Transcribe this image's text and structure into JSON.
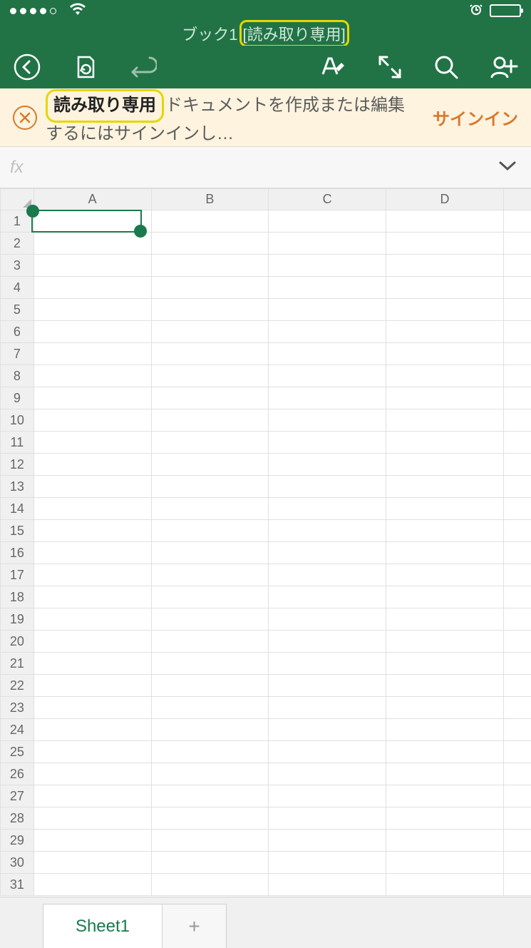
{
  "title": {
    "name": "ブック1",
    "suffix": "[読み取り専用]"
  },
  "banner": {
    "strong": "読み取り専用",
    "text_rest": "ドキュメントを作成または編集するにはサインインし…",
    "cta": "サインイン"
  },
  "formula_bar": {
    "fx": "fx",
    "value": ""
  },
  "columns": [
    "A",
    "B",
    "C",
    "D",
    ""
  ],
  "rows": [
    "1",
    "2",
    "3",
    "4",
    "5",
    "6",
    "7",
    "8",
    "9",
    "10",
    "11",
    "12",
    "13",
    "14",
    "15",
    "16",
    "17",
    "18",
    "19",
    "20",
    "21",
    "22",
    "23",
    "24",
    "25",
    "26",
    "27",
    "28",
    "29",
    "30",
    "31"
  ],
  "selected_cell": "A1",
  "sheet": {
    "active": "Sheet1",
    "add": "+"
  }
}
